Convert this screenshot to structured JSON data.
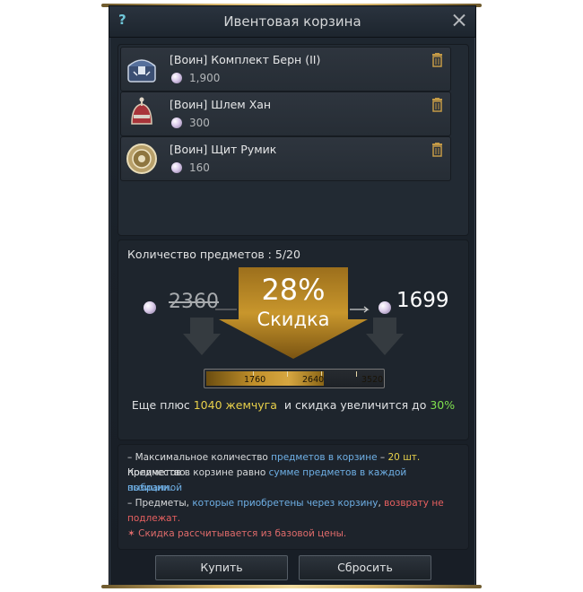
{
  "window": {
    "title": "Ивентовая корзина",
    "help": "?"
  },
  "items": [
    {
      "name": "[Воин] Комплект Берн (II)",
      "price": "1,900",
      "icon": "chest-icon"
    },
    {
      "name": "[Воин] Шлем Хан",
      "price": "300",
      "icon": "helmet-icon"
    },
    {
      "name": "[Воин] Щит Румик",
      "price": "160",
      "icon": "shield-icon"
    }
  ],
  "discount": {
    "count_label": "Количество предметов : 5/20",
    "old_price": "2360",
    "new_price": "1699",
    "percent": "28%",
    "label": "Скидка",
    "bar": {
      "ticks": [
        "1760",
        "2640",
        "3520"
      ],
      "max": 3520,
      "value": 2360
    },
    "hint": {
      "part1": "Еще плюс ",
      "amount": "1040 жемчуга",
      "part2": "  и скидка увеличится до ",
      "next_percent": "30%"
    }
  },
  "info": {
    "l1a": "– Максимальное количество ",
    "l1b": "предметов в корзине",
    "l1c": " – ",
    "l1d": "20 шт.",
    "l1e": " Количество",
    "l2a": "предметов в корзине равно ",
    "l2b": "сумме предметов в каждой выбранной",
    "l3": "позиции.",
    "l4a": "– Предметы, ",
    "l4b": "которые приобретены через корзину",
    "l4c": ", ",
    "l4d": "возврату не",
    "l5": "подлежат.",
    "l6": "✶ Скидка рассчитывается из базовой цены."
  },
  "buttons": {
    "buy": "Купить",
    "reset": "Сбросить"
  },
  "colors": {
    "accent_gold": "#c8962c",
    "highlight_yellow": "#e8d04a",
    "highlight_green": "#7fe04e",
    "link_blue": "#6fb0e6",
    "warning_red": "#e86060"
  }
}
